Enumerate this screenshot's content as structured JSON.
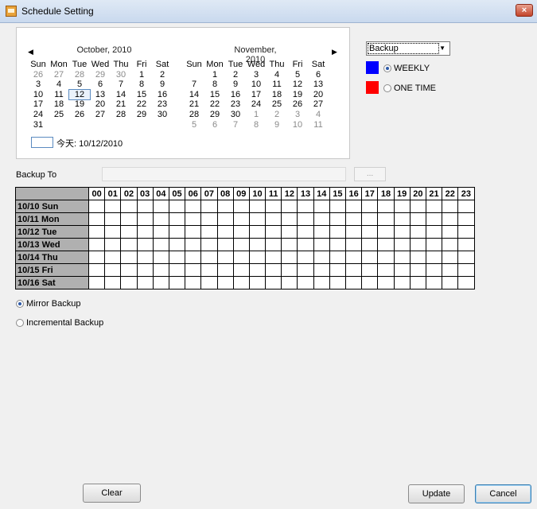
{
  "window": {
    "title": "Schedule Setting",
    "close_label": "×"
  },
  "calendar": {
    "months": [
      {
        "title": "October, 2010",
        "weekdays": [
          "Sun",
          "Mon",
          "Tue",
          "Wed",
          "Thu",
          "Fri",
          "Sat"
        ],
        "days": [
          [
            "26",
            "27",
            "28",
            "29",
            "30",
            "1",
            "2"
          ],
          [
            "3",
            "4",
            "5",
            "6",
            "7",
            "8",
            "9"
          ],
          [
            "10",
            "11",
            "12",
            "13",
            "14",
            "15",
            "16"
          ],
          [
            "17",
            "18",
            "19",
            "20",
            "21",
            "22",
            "23"
          ],
          [
            "24",
            "25",
            "26",
            "27",
            "28",
            "29",
            "30"
          ],
          [
            "31",
            "",
            "",
            "",
            "",
            "",
            ""
          ]
        ],
        "dim_cells": [
          [
            0,
            0
          ],
          [
            0,
            1
          ],
          [
            0,
            2
          ],
          [
            0,
            3
          ],
          [
            0,
            4
          ]
        ],
        "selected_day": "12"
      },
      {
        "title": "November, 2010",
        "weekdays": [
          "Sun",
          "Mon",
          "Tue",
          "Wed",
          "Thu",
          "Fri",
          "Sat"
        ],
        "days": [
          [
            "",
            "1",
            "2",
            "3",
            "4",
            "5",
            "6"
          ],
          [
            "7",
            "8",
            "9",
            "10",
            "11",
            "12",
            "13"
          ],
          [
            "14",
            "15",
            "16",
            "17",
            "18",
            "19",
            "20"
          ],
          [
            "21",
            "22",
            "23",
            "24",
            "25",
            "26",
            "27"
          ],
          [
            "28",
            "29",
            "30",
            "1",
            "2",
            "3",
            "4"
          ],
          [
            "5",
            "6",
            "7",
            "8",
            "9",
            "10",
            "11"
          ]
        ],
        "dim_cells": [
          [
            4,
            3
          ],
          [
            4,
            4
          ],
          [
            4,
            5
          ],
          [
            4,
            6
          ],
          [
            5,
            0
          ],
          [
            5,
            1
          ],
          [
            5,
            2
          ],
          [
            5,
            3
          ],
          [
            5,
            4
          ],
          [
            5,
            5
          ],
          [
            5,
            6
          ]
        ],
        "selected_day": ""
      }
    ],
    "today_label": "今天: 10/12/2010"
  },
  "mode_select": {
    "value": "Backup"
  },
  "schedule_types": [
    {
      "label": "WEEKLY",
      "color": "#0000ff",
      "selected": true
    },
    {
      "label": "ONE TIME",
      "color": "#ff0000",
      "selected": false
    }
  ],
  "backup_to": {
    "label": "Backup To",
    "value": "",
    "browse_label": "..."
  },
  "schedule_grid": {
    "hours": [
      "00",
      "01",
      "02",
      "03",
      "04",
      "05",
      "06",
      "07",
      "08",
      "09",
      "10",
      "11",
      "12",
      "13",
      "14",
      "15",
      "16",
      "17",
      "18",
      "19",
      "20",
      "21",
      "22",
      "23"
    ],
    "days": [
      "10/10 Sun",
      "10/11 Mon",
      "10/12 Tue",
      "10/13 Wed",
      "10/14 Thu",
      "10/15 Fri",
      "10/16 Sat"
    ]
  },
  "backup_modes": [
    {
      "label": "Mirror Backup",
      "selected": true
    },
    {
      "label": "Incremental Backup",
      "selected": false
    }
  ],
  "buttons": {
    "clear": "Clear",
    "update": "Update",
    "cancel": "Cancel"
  },
  "colors": {
    "accent": "#3c7fb1",
    "header_gray": "#b0b0b0"
  }
}
